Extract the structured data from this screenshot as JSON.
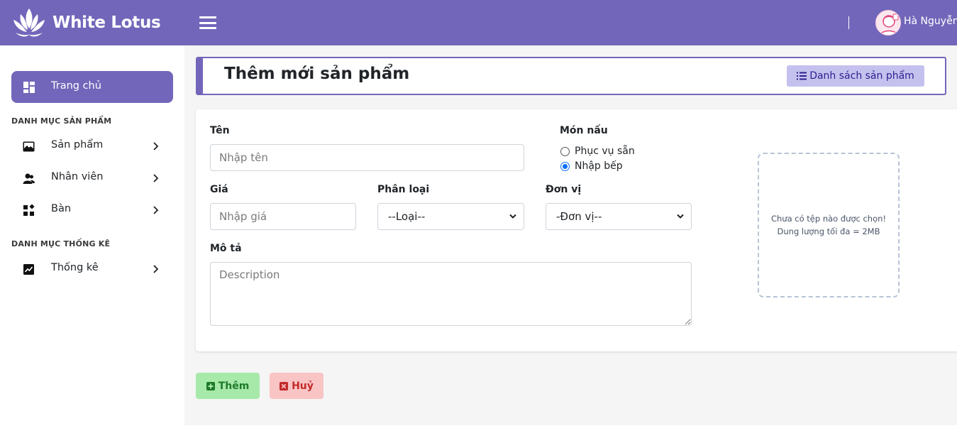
{
  "header": {
    "brand_name": "White Lotus",
    "user_name": "Hà Nguyễn",
    "colors": {
      "primary": "#7266ba"
    }
  },
  "sidebar": {
    "home_label": "Trang chủ",
    "section_products": "DANH MỤC SẢN PHẨM",
    "items": [
      {
        "label": "Sản phẩm",
        "icon": "image-icon"
      },
      {
        "label": "Nhân viên",
        "icon": "users-icon"
      },
      {
        "label": "Bàn",
        "icon": "widgets-icon"
      }
    ],
    "section_stats": "DANH MỤC THỐNG KÊ",
    "stats_items": [
      {
        "label": "Thống kê",
        "icon": "chart-icon"
      }
    ]
  },
  "main": {
    "title": "Thêm mới sản phẩm",
    "list_button": "Danh sách sản phẩm",
    "form": {
      "name_label": "Tên",
      "name_placeholder": "Nhập tên",
      "cook_label": "Món nấu",
      "radio_ready": "Phục vụ sẵn",
      "radio_kitchen": "Nhập bếp",
      "radio_selected": "Nhập bếp",
      "price_label": "Giá",
      "price_placeholder": "Nhập giá",
      "category_label": "Phân loại",
      "category_value": "--Loại--",
      "unit_label": "Đơn vị",
      "unit_value": "-Đơn vị--",
      "desc_label": "Mô tả",
      "desc_placeholder": "Description",
      "dropzone_line1": "Chưa có tệp nào được chọn!",
      "dropzone_line2": "Dung lượng tối đa = 2MB"
    },
    "add_button": "Thêm",
    "cancel_button": "Huỷ"
  }
}
